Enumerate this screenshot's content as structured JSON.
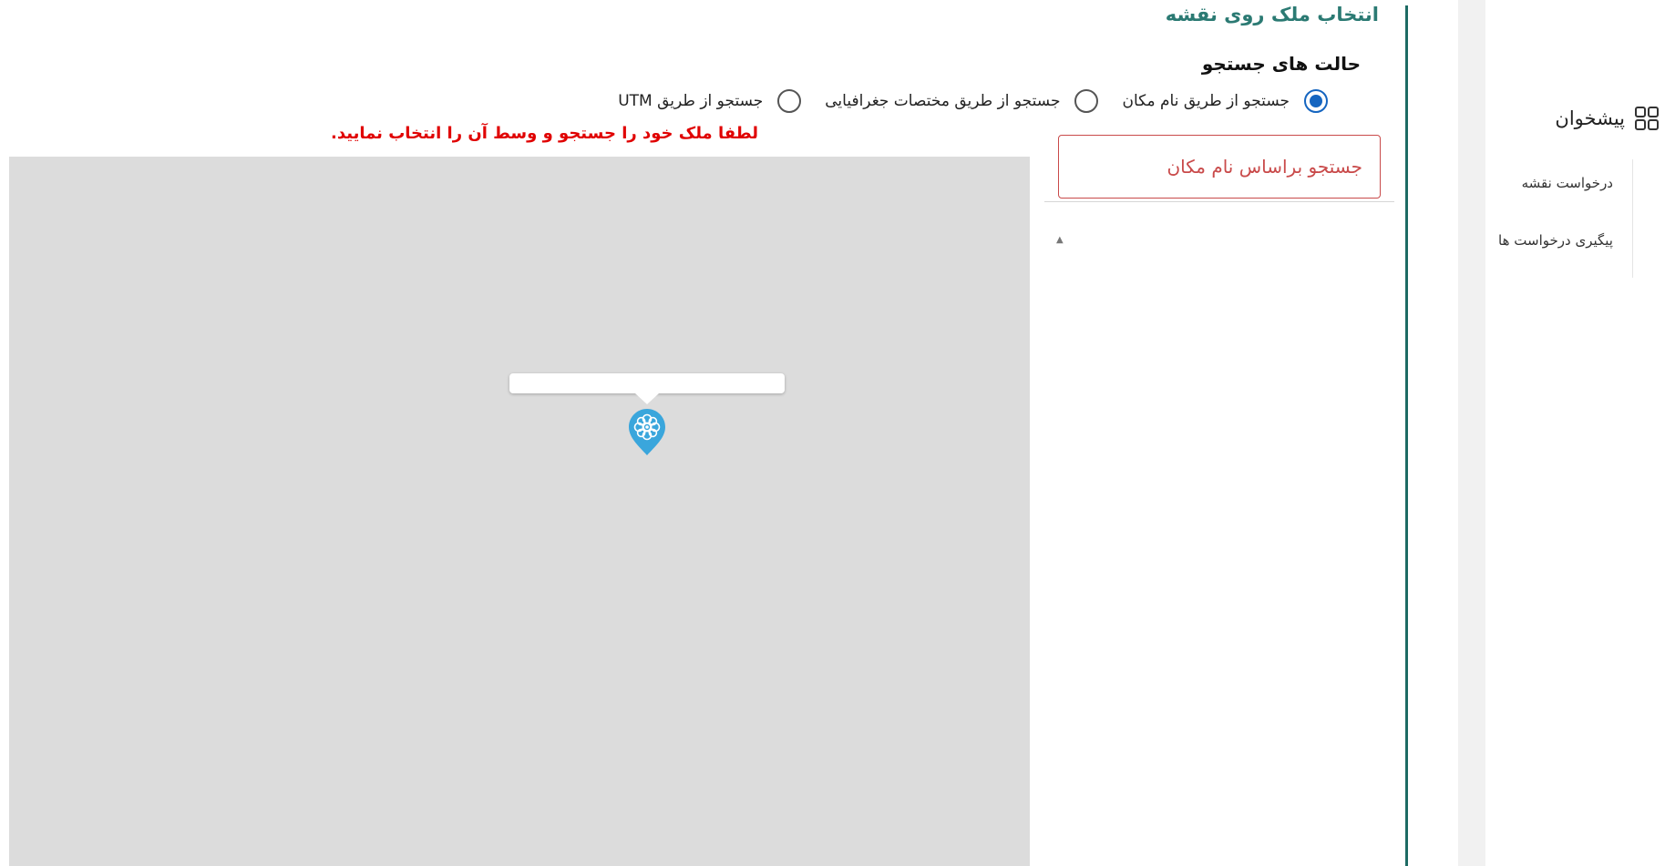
{
  "sidebar": {
    "header_label": "پیشخوان",
    "header_icon": "grid-icon",
    "items": [
      {
        "label": "درخواست نقشه"
      },
      {
        "label": "پیگیری درخواست ها"
      }
    ]
  },
  "main": {
    "title": "انتخاب ملک روی نقشه",
    "modes_heading": "حالت های جستجو",
    "search_modes": [
      {
        "label": "جستجو از طریق نام مکان",
        "selected": true
      },
      {
        "label": "جستجو از طریق مختصات جغرافیایی",
        "selected": false
      },
      {
        "label": "جستجو از طریق UTM",
        "selected": false
      }
    ],
    "search": {
      "placeholder": "جستجو براساس نام مکان",
      "value": ""
    },
    "error_message": "لطفا ملک خود را جستجو و وسط آن را انتخاب نمایید.",
    "results_caret": "▲"
  },
  "map": {
    "background_color": "#dcdcdc",
    "marker_icon": "location-pin-icon",
    "marker_color": "#3aa6dc"
  },
  "colors": {
    "accent": "#1d6b64",
    "title": "#2b7a73",
    "error": "#e00000",
    "radio_selected": "#1565c0"
  }
}
